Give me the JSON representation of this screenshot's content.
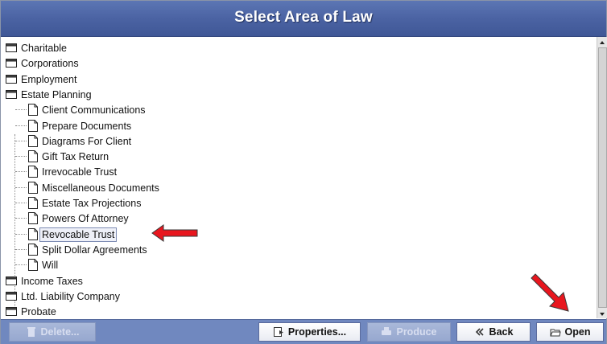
{
  "window": {
    "title": "Select Area of Law"
  },
  "tree": {
    "rows": [
      {
        "type": "folder",
        "label": "Charitable"
      },
      {
        "type": "folder",
        "label": "Corporations"
      },
      {
        "type": "folder",
        "label": "Employment"
      },
      {
        "type": "folder",
        "label": "Estate Planning"
      },
      {
        "type": "doc",
        "label": "Client Communications"
      },
      {
        "type": "doc",
        "label": "Prepare Documents"
      },
      {
        "type": "doc",
        "label": "Diagrams For Client"
      },
      {
        "type": "doc",
        "label": "Gift Tax Return"
      },
      {
        "type": "doc",
        "label": "Irrevocable Trust"
      },
      {
        "type": "doc",
        "label": "Miscellaneous Documents"
      },
      {
        "type": "doc",
        "label": "Estate Tax Projections"
      },
      {
        "type": "doc",
        "label": "Powers Of Attorney"
      },
      {
        "type": "doc",
        "label": "Revocable Trust",
        "selected": true
      },
      {
        "type": "doc",
        "label": "Split Dollar Agreements"
      },
      {
        "type": "doc",
        "label": "Will"
      },
      {
        "type": "folder",
        "label": "Income Taxes"
      },
      {
        "type": "folder",
        "label": "Ltd. Liability Company"
      },
      {
        "type": "folder",
        "label": "Probate"
      }
    ]
  },
  "buttons": {
    "delete": "Delete...",
    "properties": "Properties...",
    "produce": "Produce",
    "back": "Back",
    "open": "Open"
  },
  "annotations": {
    "arrow_color": "#e8161e"
  }
}
